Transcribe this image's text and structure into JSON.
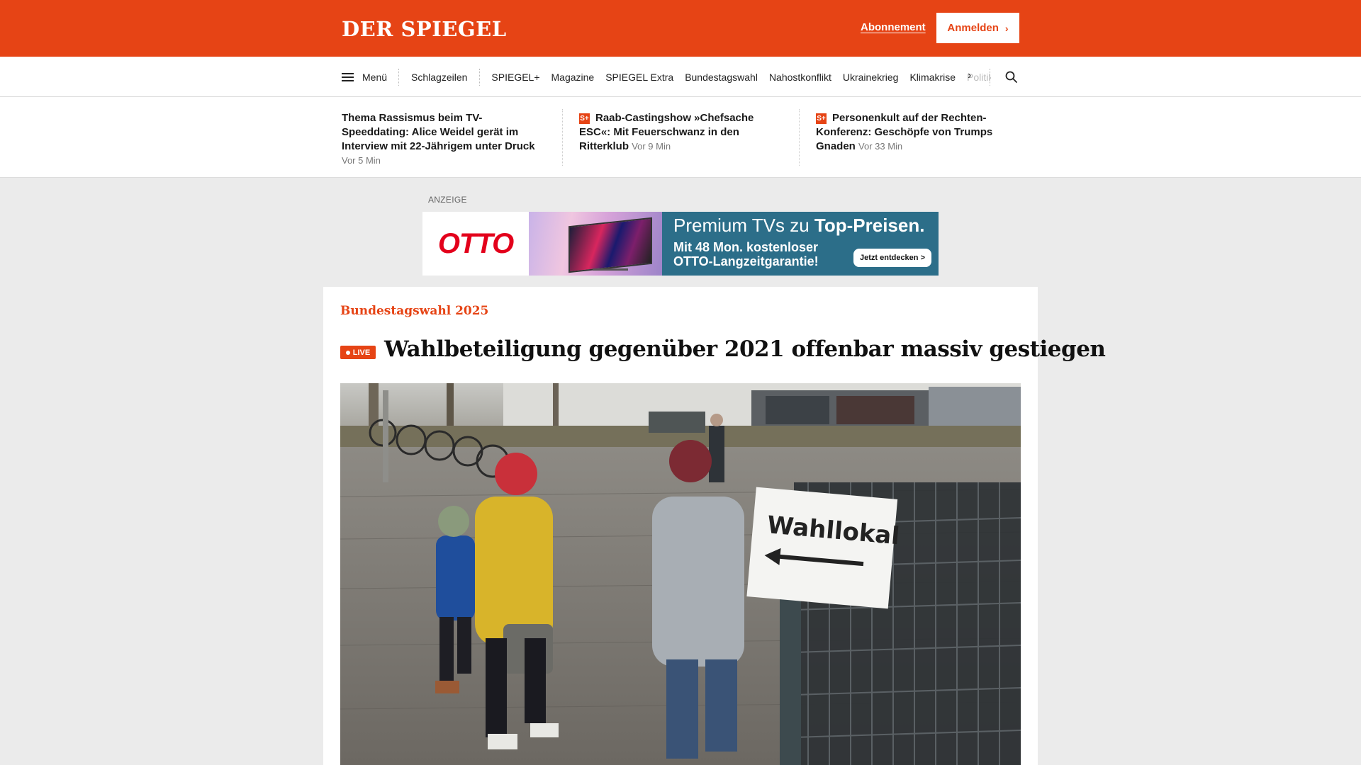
{
  "header": {
    "logo": "DER SPIEGEL",
    "subscription_link": "Abonnement",
    "login_button": "Anmelden",
    "brand_color": "#e64415"
  },
  "nav": {
    "menu_label": "Menü",
    "items": [
      "Schlagzeilen",
      "SPIEGEL+",
      "Magazine",
      "SPIEGEL Extra",
      "Bundestagswahl",
      "Nahostkonflikt",
      "Ukrainekrieg",
      "Klimakrise",
      "Politik"
    ],
    "more_icon": "chevron-right-icon",
    "search_icon": "search-icon"
  },
  "teasers": [
    {
      "title": "Thema Rassismus beim TV-Speeddating: Alice Weidel gerät im Interview mit 22-Jährigem unter Druck",
      "time": "Vor 5 Min",
      "plus": false
    },
    {
      "title": "Raab-Castingshow »Chefsache ESC«: Mit Feuerschwanz in den Ritterklub",
      "time": "Vor 9 Min",
      "plus": true
    },
    {
      "title": "Personenkult auf der Rechten-Konferenz: Geschöpfe von Trumps Gnaden",
      "time": "Vor 33 Min",
      "plus": true
    }
  ],
  "plus_badge": "S+",
  "ad": {
    "label": "ANZEIGE",
    "brand": "OTTO",
    "line1_regular": "Premium TVs zu ",
    "line1_bold": "Top-Preisen.",
    "line2": "Mit 48 Mon. kostenloser OTTO-Langzeitgarantie!",
    "cta": "Jetzt entdecken >"
  },
  "article": {
    "kicker": "Bundestagswahl 2025",
    "live_label": "LIVE",
    "headline": "Wahlbeteiligung gegenüber 2021 offenbar massiv gestiegen",
    "photo_sign": "Wahllokal"
  }
}
